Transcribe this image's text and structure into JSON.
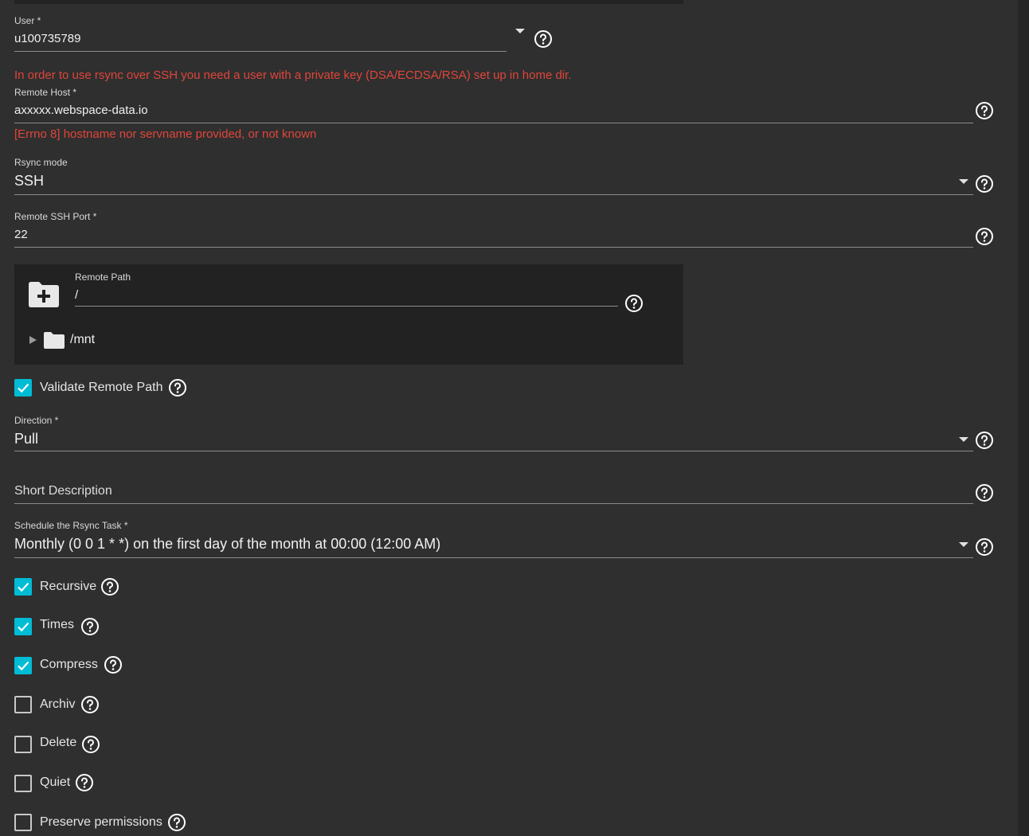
{
  "form": {
    "user": {
      "label": "User *",
      "value": "u100735789"
    },
    "ssh_key_error": "In order to use rsync over SSH you need a user with a private key (DSA/ECDSA/RSA) set up in home dir.",
    "remote_host": {
      "label": "Remote Host *",
      "value": "axxxxx.webspace-data.io",
      "error": "[Errno 8] hostname nor servname provided, or not known"
    },
    "rsync_mode": {
      "label": "Rsync mode",
      "value": "SSH"
    },
    "remote_ssh_port": {
      "label": "Remote SSH Port *",
      "value": "22"
    },
    "remote_path": {
      "label": "Remote Path",
      "value": "/",
      "tree_root": "/mnt"
    },
    "validate_remote_path": {
      "label": "Validate Remote Path",
      "checked": true
    },
    "direction": {
      "label": "Direction *",
      "value": "Pull"
    },
    "short_description": {
      "placeholder": "Short Description"
    },
    "schedule": {
      "label": "Schedule the Rsync Task *",
      "value": "Monthly (0 0 1 * *) on the first day of the month at 00:00 (12:00 AM)"
    },
    "options": [
      {
        "label": "Recursive",
        "checked": true
      },
      {
        "label": "Times",
        "checked": true
      },
      {
        "label": "Compress",
        "checked": true
      },
      {
        "label": "Archiv",
        "checked": false
      },
      {
        "label": "Delete",
        "checked": false
      },
      {
        "label": "Quiet",
        "checked": false
      },
      {
        "label": "Preserve permissions",
        "checked": false
      }
    ]
  },
  "icons": {
    "help": "help-circle-icon",
    "dropdown": "caret-down-icon",
    "folder_add": "folder-plus-icon",
    "folder": "folder-icon",
    "tree_expand": "triangle-right-icon",
    "check": "checkmark-icon"
  },
  "colors": {
    "background": "#2f2f2f",
    "error": "#e0453a",
    "accent": "#00bcd4",
    "panel": "#222222"
  }
}
